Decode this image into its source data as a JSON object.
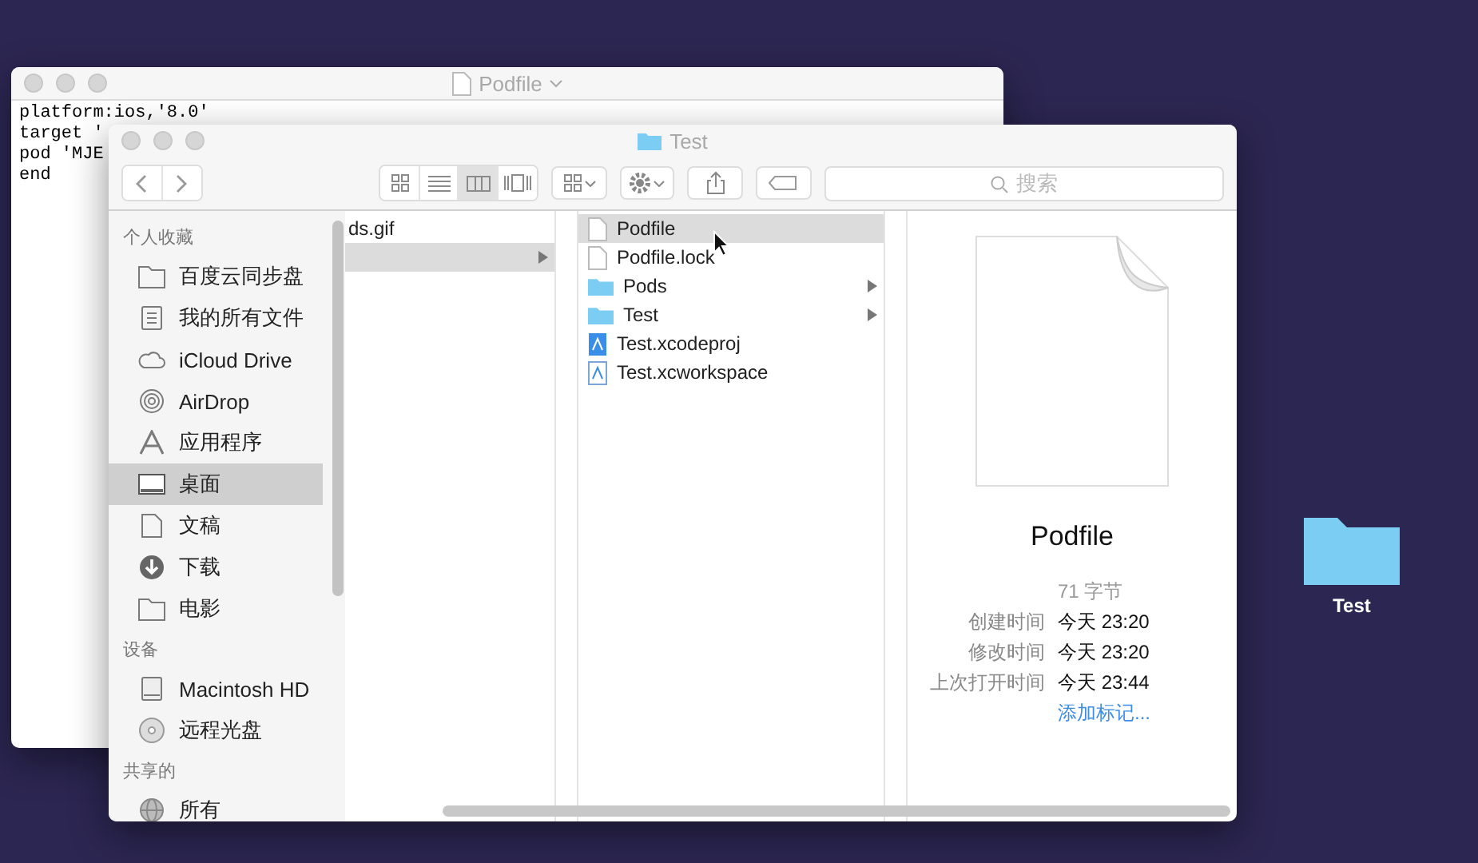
{
  "editor": {
    "title": "Podfile",
    "lines": [
      "platform:ios,'8.0'",
      "target '",
      "pod 'MJE",
      "end"
    ]
  },
  "finder": {
    "title": "Test",
    "view_buttons": [
      {
        "kind": "icons",
        "selected": false
      },
      {
        "kind": "list",
        "selected": false
      },
      {
        "kind": "columns",
        "selected": true
      },
      {
        "kind": "coverflow",
        "selected": false
      }
    ],
    "search": {
      "placeholder": "搜索"
    },
    "sidebar": [
      {
        "heading": "个人收藏",
        "items": [
          {
            "label": "百度云同步盘",
            "selected": false
          },
          {
            "label": "我的所有文件",
            "selected": false
          },
          {
            "label": "iCloud Drive",
            "selected": false
          },
          {
            "label": "AirDrop",
            "selected": false
          },
          {
            "label": "应用程序",
            "selected": false
          },
          {
            "label": "桌面",
            "selected": true
          },
          {
            "label": "文稿",
            "selected": false
          },
          {
            "label": "下载",
            "selected": false
          },
          {
            "label": "电影",
            "selected": false
          }
        ]
      },
      {
        "heading": "设备",
        "items": [
          {
            "label": "Macintosh HD",
            "selected": false
          },
          {
            "label": "远程光盘",
            "selected": false
          }
        ]
      },
      {
        "heading": "共享的",
        "items": [
          {
            "label": "所有",
            "selected": false
          }
        ]
      }
    ],
    "column_1": [
      {
        "label": "ds.gif",
        "selected": false,
        "has_children": false
      },
      {
        "selected": true,
        "has_children": true
      }
    ],
    "column_2": [
      {
        "label": "Podfile",
        "kind": "file",
        "selected": true,
        "has_children": false
      },
      {
        "label": "Podfile.lock",
        "kind": "file",
        "selected": false,
        "has_children": false
      },
      {
        "label": "Pods",
        "kind": "folder",
        "selected": false,
        "has_children": true
      },
      {
        "label": "Test",
        "kind": "folder",
        "selected": false,
        "has_children": true
      },
      {
        "label": "Test.xcodeproj",
        "kind": "project",
        "selected": false,
        "has_children": false
      },
      {
        "label": "Test.xcworkspace",
        "kind": "workspace",
        "selected": false,
        "has_children": false
      }
    ],
    "preview": {
      "name": "Podfile",
      "size": "71 字节",
      "rows": [
        {
          "label": "创建时间",
          "value": "今天 23:20"
        },
        {
          "label": "修改时间",
          "value": "今天 23:20"
        },
        {
          "label": "上次打开时间",
          "value": "今天 23:44"
        }
      ],
      "add_tags": "添加标记..."
    }
  },
  "desktop_icons": [
    {
      "label": "Test"
    }
  ]
}
